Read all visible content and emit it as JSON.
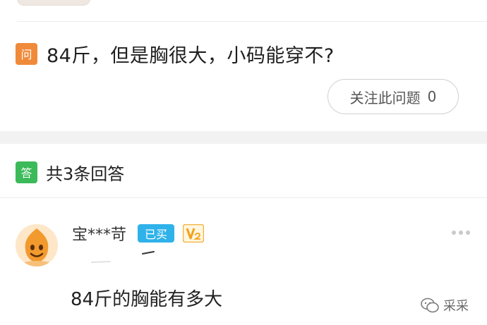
{
  "question": {
    "tag": "问",
    "text": "84斤，但是胸很大，小码能穿不?",
    "follow_label": "关注此问题",
    "follow_count": "0"
  },
  "answers_header": {
    "tag": "答",
    "count_label": "共3条回答"
  },
  "answer": {
    "username": "宝***苛",
    "bought_badge": "已买",
    "level_icon": "v2-level-icon",
    "text": "84斤的胸能有多大"
  },
  "watermark": {
    "text": "采采"
  },
  "colors": {
    "question_tag": "#f08a3b",
    "answer_tag": "#3cba5a",
    "bought_badge": "#2fb2ea",
    "level_badge": "#f3b23a"
  }
}
